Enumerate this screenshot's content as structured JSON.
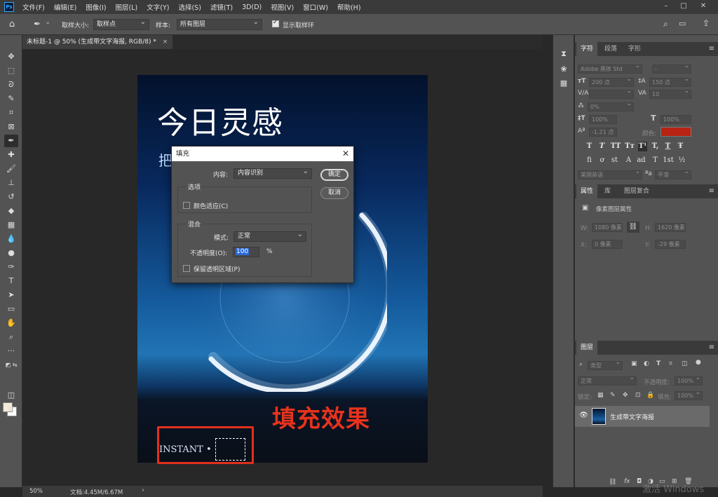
{
  "app": {
    "logo": "Ps"
  },
  "menu": [
    "文件(F)",
    "编辑(E)",
    "图像(I)",
    "图层(L)",
    "文字(Y)",
    "选择(S)",
    "滤镜(T)",
    "3D(D)",
    "视图(V)",
    "窗口(W)",
    "帮助(H)"
  ],
  "options_bar": {
    "sample_size_label": "取样大小:",
    "sample_size_value": "取样点",
    "sample_label": "样本:",
    "sample_value": "所有图层",
    "show_ring_label": "显示取样环",
    "show_ring_checked": true
  },
  "document_tab": {
    "title": "未标题-1 @ 50% (生成带文字海报, RGB/8) *",
    "close": "×"
  },
  "poster": {
    "title": "今日灵感",
    "subtitle": "把",
    "instant_text": "INSTANT",
    "instant_dot": "•"
  },
  "annotation": {
    "text": "填充效果",
    "color": "#e8321c"
  },
  "fill_dialog": {
    "title": "填充",
    "content_label": "内容:",
    "content_value": "内容识别",
    "ok_label": "确定",
    "cancel_label": "取消",
    "options_group": "选项",
    "color_adapt_label": "颜色适应(C)",
    "color_adapt_checked": false,
    "blend_group": "混合",
    "mode_label": "模式:",
    "mode_value": "正常",
    "opacity_label": "不透明度(O):",
    "opacity_value": "100",
    "opacity_unit": "%",
    "preserve_label": "保留透明区域(P)",
    "preserve_checked": false
  },
  "character_panel": {
    "tabs": [
      "字符",
      "段落",
      "字形"
    ],
    "font_family": "Adobe 黑体 Std",
    "font_style": "-",
    "font_size": "200 点",
    "leading": "150 点",
    "kerning": "",
    "tracking": "10",
    "scale_percent": "0%",
    "vertical_scale": "100%",
    "horizontal_scale": "100%",
    "baseline_shift": "-1.21 点",
    "color_label": "颜色:",
    "text_color": "#b82314",
    "style_buttons": [
      "T",
      "T",
      "TT",
      "Tт",
      "T¹",
      "T,",
      "T",
      "Ŧ"
    ],
    "opentype_buttons": [
      "fi",
      "ơ",
      "st",
      "A",
      "ad",
      "T",
      "1st",
      "½"
    ],
    "language": "美国英语",
    "aa_label": "ªa",
    "antialias": "平滑"
  },
  "properties_panel": {
    "tabs": [
      "属性",
      "库",
      "图层复合"
    ],
    "heading": "像素图层属性",
    "w_label": "W:",
    "w_value": "1080 像素",
    "h_label": "H:",
    "h_value": "1620 像素",
    "x_label": "X:",
    "x_value": "0 像素",
    "y_label": "Y:",
    "y_value": "-29 像素"
  },
  "layers_panel": {
    "tab": "图层",
    "filter_kind": "类型",
    "blend_mode": "正常",
    "opacity_label": "不透明度:",
    "opacity_value": "100%",
    "lock_label": "锁定:",
    "fill_label": "填充:",
    "fill_value": "100%",
    "layer_name": "生成带文字海报",
    "footer_icons": [
      "link-icon",
      "fx-icon",
      "mask-icon",
      "adjustment-icon",
      "group-icon",
      "new-layer-icon",
      "trash-icon"
    ]
  },
  "status_bar": {
    "zoom": "50%",
    "doc_info": "文档:4.45M/6.67M",
    "arrow": "›"
  },
  "watermark": "激活 Windows"
}
